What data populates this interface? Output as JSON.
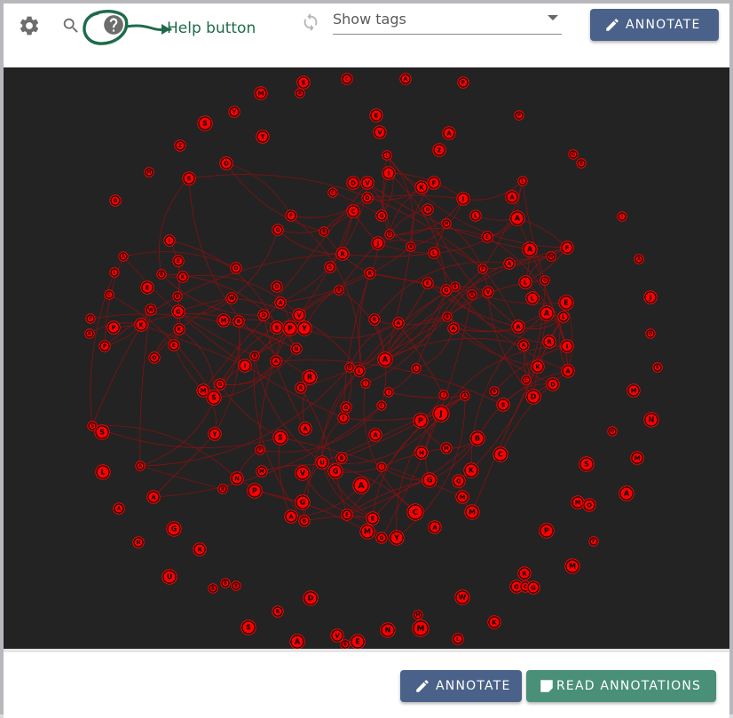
{
  "toolbar": {
    "settings_icon": "gear-icon",
    "search_icon": "search-icon",
    "help_icon": "help-circle-icon",
    "help_label": "Help button",
    "refresh_icon": "refresh-icon",
    "tags_select": {
      "value": "Show tags"
    },
    "annotate_label": "ANNOTATE"
  },
  "footer": {
    "annotate_label": "ANNOTATE",
    "read_label": "READ ANNOTATIONS"
  },
  "colors": {
    "canvas_bg": "#232323",
    "node_fill": "#ff0000",
    "edge": "#8a1010",
    "annotate_button": "#4a6189",
    "read_button": "#4a8f78",
    "help_highlight": "#1e6b4a"
  },
  "graph": {
    "nodes": [
      [
        "S",
        338,
        89,
        6
      ],
      [
        "C",
        387,
        85,
        5
      ],
      [
        "A",
        453,
        85,
        5
      ],
      [
        "P",
        518,
        89,
        5
      ],
      [
        "M",
        290,
        101,
        6
      ],
      [
        "B",
        334,
        101,
        4
      ],
      [
        "E",
        420,
        126,
        6
      ],
      [
        "A",
        502,
        146,
        6
      ],
      [
        "P",
        581,
        126,
        4
      ],
      [
        "Y",
        260,
        122,
        5
      ],
      [
        "S",
        227,
        135,
        7
      ],
      [
        "T",
        292,
        150,
        6
      ],
      [
        "Z",
        199,
        160,
        5
      ],
      [
        "V",
        424,
        145,
        6
      ],
      [
        "Z",
        491,
        165,
        6
      ],
      [
        "L",
        432,
        171,
        4
      ],
      [
        "O",
        251,
        180,
        6
      ],
      [
        "M",
        164,
        190,
        4
      ],
      [
        "S",
        209,
        197,
        6
      ],
      [
        "I",
        434,
        191,
        6
      ],
      [
        "K",
        471,
        207,
        6
      ],
      [
        "F",
        485,
        202,
        6
      ],
      [
        "D",
        394,
        202,
        6
      ],
      [
        "V",
        410,
        202,
        6
      ],
      [
        "G",
        642,
        170,
        4
      ],
      [
        "B",
        651,
        180,
        4
      ],
      [
        "L",
        585,
        200,
        4
      ],
      [
        "A",
        573,
        218,
        6
      ],
      [
        "I",
        518,
        220,
        6
      ],
      [
        "D",
        410,
        219,
        5
      ],
      [
        "C",
        371,
        213,
        4
      ],
      [
        "G",
        126,
        222,
        5
      ],
      [
        "F",
        324,
        239,
        5
      ],
      [
        "C",
        394,
        234,
        6
      ],
      [
        "G",
        426,
        239,
        5
      ],
      [
        "G",
        478,
        232,
        5
      ],
      [
        "L",
        532,
        239,
        5
      ],
      [
        "A",
        579,
        242,
        7
      ],
      [
        "G",
        309,
        255,
        5
      ],
      [
        "B",
        361,
        257,
        4
      ],
      [
        "H",
        499,
        248,
        4
      ],
      [
        "I",
        187,
        267,
        5
      ],
      [
        "D",
        435,
        260,
        4
      ],
      [
        "J",
        422,
        270,
        6
      ],
      [
        "B",
        459,
        274,
        4
      ],
      [
        "E",
        545,
        263,
        5
      ],
      [
        "I",
        697,
        240,
        4
      ],
      [
        "A",
        593,
        277,
        7
      ],
      [
        "F",
        635,
        275,
        6
      ],
      [
        "A",
        135,
        285,
        4
      ],
      [
        "E",
        197,
        290,
        5
      ],
      [
        "R",
        382,
        282,
        6
      ],
      [
        "L",
        485,
        281,
        5
      ],
      [
        "W",
        617,
        285,
        4
      ],
      [
        "A",
        716,
        288,
        4
      ],
      [
        "L",
        125,
        303,
        4
      ],
      [
        "B",
        178,
        305,
        4
      ],
      [
        "K",
        202,
        308,
        5
      ],
      [
        "O",
        262,
        298,
        5
      ],
      [
        "S",
        368,
        297,
        5
      ],
      [
        "F",
        540,
        299,
        4
      ],
      [
        "A",
        570,
        293,
        5
      ],
      [
        "R",
        413,
        304,
        5
      ],
      [
        "E",
        478,
        315,
        5
      ],
      [
        "E",
        509,
        319,
        4
      ],
      [
        "G",
        499,
        323,
        5
      ],
      [
        "V",
        546,
        325,
        5
      ],
      [
        "L",
        588,
        314,
        6
      ],
      [
        "G",
        610,
        312,
        4
      ],
      [
        "D",
        308,
        319,
        5
      ],
      [
        "C",
        119,
        328,
        4
      ],
      [
        "E",
        162,
        320,
        6
      ],
      [
        "B",
        196,
        330,
        4
      ],
      [
        "W",
        257,
        332,
        5
      ],
      [
        "A",
        312,
        337,
        5
      ],
      [
        "R",
        378,
        323,
        4
      ],
      [
        "B",
        528,
        328,
        4
      ],
      [
        "L",
        596,
        332,
        6
      ],
      [
        "E",
        634,
        337,
        7
      ],
      [
        "J",
        729,
        331,
        6
      ],
      [
        "W",
        166,
        345,
        5
      ],
      [
        "G",
        197,
        347,
        6
      ],
      [
        "V",
        333,
        351,
        6
      ],
      [
        "P",
        98,
        355,
        4
      ],
      [
        "P",
        124,
        365,
        6
      ],
      [
        "K",
        155,
        362,
        6
      ],
      [
        "M",
        248,
        357,
        6
      ],
      [
        "B",
        265,
        358,
        5
      ],
      [
        "D",
        293,
        351,
        5
      ],
      [
        "R",
        418,
        356,
        5
      ],
      [
        "A",
        445,
        360,
        5
      ],
      [
        "B",
        500,
        353,
        4
      ],
      [
        "S",
        308,
        365,
        6
      ],
      [
        "P",
        323,
        366,
        7
      ],
      [
        "Y",
        339,
        366,
        7
      ],
      [
        "A",
        507,
        366,
        5
      ],
      [
        "K",
        198,
        367,
        5
      ],
      [
        "A",
        580,
        364,
        6
      ],
      [
        "A",
        612,
        349,
        7
      ],
      [
        "L",
        631,
        353,
        5
      ],
      [
        "R",
        97,
        372,
        4
      ],
      [
        "P",
        114,
        386,
        5
      ],
      [
        "E",
        192,
        385,
        5
      ],
      [
        "N",
        330,
        389,
        5
      ],
      [
        "A",
        586,
        385,
        5
      ],
      [
        "R",
        615,
        381,
        6
      ],
      [
        "I",
        635,
        386,
        6
      ],
      [
        "O",
        729,
        372,
        4
      ],
      [
        "O",
        170,
        399,
        5
      ],
      [
        "B",
        283,
        397,
        4
      ],
      [
        "A",
        307,
        403,
        5
      ],
      [
        "I",
        272,
        408,
        6
      ],
      [
        "A",
        430,
        401,
        7
      ],
      [
        "L",
        465,
        411,
        4
      ],
      [
        "D",
        390,
        410,
        4
      ],
      [
        "L",
        401,
        414,
        5
      ],
      [
        "K",
        602,
        409,
        6
      ],
      [
        "A",
        636,
        414,
        6
      ],
      [
        "E",
        737,
        410,
        4
      ],
      [
        "R",
        345,
        421,
        7
      ],
      [
        "C",
        589,
        424,
        4
      ],
      [
        "D",
        619,
        429,
        6
      ],
      [
        "R",
        335,
        433,
        5
      ],
      [
        "G",
        244,
        429,
        5
      ],
      [
        "M",
        225,
        436,
        6
      ],
      [
        "S",
        237,
        444,
        7
      ],
      [
        "I",
        408,
        428,
        4
      ],
      [
        "I",
        434,
        438,
        4
      ],
      [
        "B",
        553,
        437,
        4
      ],
      [
        "D",
        597,
        443,
        7
      ],
      [
        "M",
        710,
        436,
        6
      ],
      [
        "I",
        496,
        441,
        4
      ],
      [
        "A",
        520,
        442,
        4
      ],
      [
        "S",
        563,
        452,
        6
      ],
      [
        "G",
        386,
        455,
        5
      ],
      [
        "C",
        426,
        453,
        4
      ],
      [
        "J",
        493,
        462,
        8
      ],
      [
        "P",
        470,
        470,
        7
      ],
      [
        "I",
        383,
        467,
        5
      ],
      [
        "N",
        730,
        469,
        7
      ],
      [
        "S",
        100,
        476,
        4
      ],
      [
        "S",
        111,
        483,
        7
      ],
      [
        "Y",
        238,
        485,
        6
      ],
      [
        "A",
        340,
        479,
        6
      ],
      [
        "S",
        312,
        489,
        7
      ],
      [
        "A",
        419,
        486,
        6
      ],
      [
        "B",
        534,
        490,
        7
      ],
      [
        "P",
        289,
        503,
        4
      ],
      [
        "M",
        499,
        501,
        5
      ],
      [
        "H",
        471,
        506,
        6
      ],
      [
        "C",
        560,
        508,
        7
      ],
      [
        "B",
        381,
        512,
        5
      ],
      [
        "O",
        686,
        482,
        4
      ],
      [
        "M",
        714,
        512,
        6
      ],
      [
        "U",
        359,
        517,
        6
      ],
      [
        "G",
        374,
        527,
        7
      ],
      [
        "V",
        337,
        529,
        7
      ],
      [
        "M",
        291,
        527,
        5
      ],
      [
        "I",
        426,
        522,
        4
      ],
      [
        "K",
        527,
        526,
        7
      ],
      [
        "L",
        112,
        528,
        7
      ],
      [
        "A",
        154,
        521,
        4
      ],
      [
        "S",
        657,
        519,
        7
      ],
      [
        "N",
        263,
        535,
        6
      ],
      [
        "G",
        480,
        537,
        7
      ],
      [
        "G",
        513,
        538,
        6
      ],
      [
        "A",
        403,
        543,
        8
      ],
      [
        "P",
        283,
        549,
        7
      ],
      [
        "B",
        247,
        547,
        4
      ],
      [
        "M",
        517,
        556,
        6
      ],
      [
        "A",
        169,
        556,
        6
      ],
      [
        "G",
        337,
        562,
        7
      ],
      [
        "M",
        647,
        562,
        6
      ],
      [
        "O",
        660,
        565,
        6
      ],
      [
        "A",
        702,
        552,
        7
      ],
      [
        "A",
        130,
        569,
        5
      ],
      [
        "C",
        464,
        573,
        8
      ],
      [
        "M",
        528,
        573,
        7
      ],
      [
        "E",
        387,
        576,
        5
      ],
      [
        "E",
        416,
        580,
        6
      ],
      [
        "A",
        324,
        578,
        6
      ],
      [
        "B",
        339,
        583,
        5
      ],
      [
        "M",
        410,
        595,
        7
      ],
      [
        "G",
        426,
        602,
        5
      ],
      [
        "Y",
        443,
        602,
        7
      ],
      [
        "A",
        486,
        590,
        6
      ],
      [
        "P",
        612,
        594,
        7
      ],
      [
        "N",
        152,
        607,
        5
      ],
      [
        "G",
        192,
        592,
        7
      ],
      [
        "R",
        221,
        615,
        6
      ],
      [
        "F",
        665,
        606,
        4
      ],
      [
        "M",
        641,
        634,
        7
      ],
      [
        "U",
        187,
        646,
        7
      ],
      [
        "K",
        587,
        642,
        6
      ],
      [
        "B",
        236,
        659,
        4
      ],
      [
        "B",
        250,
        653,
        4
      ],
      [
        "B",
        262,
        656,
        4
      ],
      [
        "G",
        578,
        657,
        6
      ],
      [
        "C",
        588,
        657,
        5
      ],
      [
        "G",
        597,
        658,
        6
      ],
      [
        "D",
        346,
        670,
        7
      ],
      [
        "W",
        517,
        669,
        7
      ],
      [
        "M",
        467,
        689,
        4
      ],
      [
        "K",
        553,
        697,
        6
      ],
      [
        "R",
        309,
        685,
        5
      ],
      [
        "S",
        276,
        703,
        7
      ],
      [
        "V",
        376,
        712,
        6
      ],
      [
        "M",
        470,
        704,
        8
      ],
      [
        "N",
        433,
        706,
        7
      ],
      [
        "B",
        385,
        722,
        4
      ],
      [
        "E",
        399,
        719,
        7
      ],
      [
        "A",
        331,
        719,
        7
      ],
      [
        "L",
        512,
        716,
        5
      ]
    ]
  }
}
